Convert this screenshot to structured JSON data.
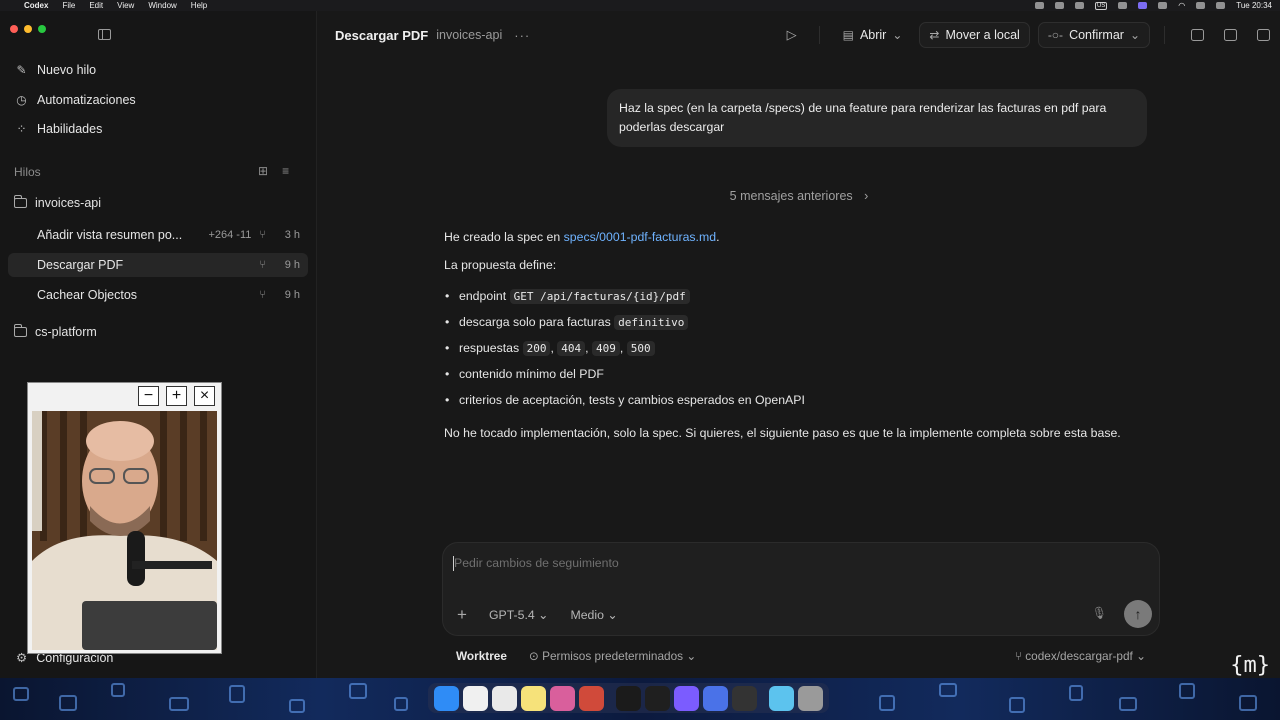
{
  "menubar": {
    "app": "Codex",
    "menus": [
      "File",
      "Edit",
      "View",
      "Window",
      "Help"
    ],
    "clock": "Tue 20:34",
    "input_source": "US"
  },
  "sidebar": {
    "nav": [
      {
        "label": "Nuevo hilo",
        "icon": "compose-icon"
      },
      {
        "label": "Automatizaciones",
        "icon": "clock-icon"
      },
      {
        "label": "Habilidades",
        "icon": "grid-icon"
      }
    ],
    "section_label": "Hilos",
    "projects": [
      {
        "name": "invoices-api",
        "threads": [
          {
            "title": "Añadir vista resumen po...",
            "diff": "+264 -11",
            "time": "3 h",
            "active": false
          },
          {
            "title": "Descargar PDF",
            "diff": "",
            "time": "9 h",
            "active": true
          },
          {
            "title": "Cachear Objectos",
            "diff": "",
            "time": "9 h",
            "active": false
          }
        ]
      },
      {
        "name": "cs-platform",
        "threads": []
      }
    ],
    "settings_label": "Configuración"
  },
  "topbar": {
    "title": "Descargar PDF",
    "project": "invoices-api",
    "open_label": "Abrir",
    "move_label": "Mover a local",
    "commit_label": "Confirmar"
  },
  "conversation": {
    "user_message": "Haz la spec (en la carpeta /specs) de una feature para renderizar las facturas en pdf para poderlas descargar",
    "older_messages": "5 mensajes anteriores",
    "answer": {
      "intro_text": "He creado la spec en",
      "link": "specs/0001-pdf-facturas.md",
      "intro_end": ".",
      "lead": "La propuesta define:",
      "bullet1_text": "endpoint",
      "bullet1_code": "GET /api/facturas/{id}/pdf",
      "bullet2_text": "descarga solo para facturas",
      "bullet2_code": "definitivo",
      "bullet3_text": "respuestas",
      "bullet3_codes": [
        "200",
        "404",
        "409",
        "500"
      ],
      "bullet4_text": "contenido mínimo del PDF",
      "bullet5_text": "criterios de aceptación, tests y cambios esperados en OpenAPI",
      "closing": "No he tocado implementación, solo la spec. Si quieres, el siguiente paso es que te la implemente completa sobre esta base."
    }
  },
  "composer": {
    "placeholder": "Pedir cambios de seguimiento",
    "model": "GPT-5.4",
    "effort": "Medio"
  },
  "footer": {
    "worktree": "Worktree",
    "permissions": "Permisos predeterminados",
    "branch": "codex/descargar-pdf"
  },
  "watermark": "{m}",
  "colors": {
    "link": "#6fb3ff",
    "background": "#181818",
    "sidebar": "#161616",
    "bubble": "#262626"
  }
}
